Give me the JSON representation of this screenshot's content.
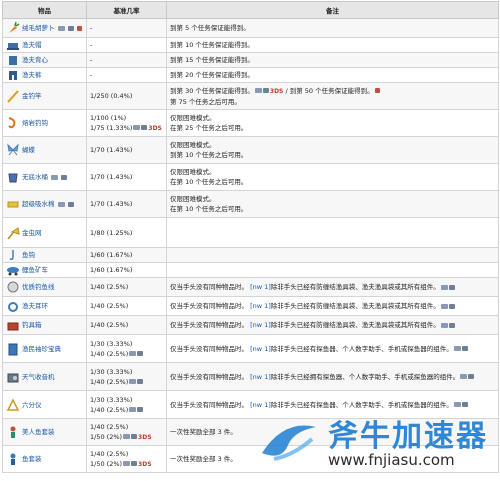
{
  "header": {
    "col_item": "物品",
    "col_rate": "基准几率",
    "col_note": "备注"
  },
  "rows": [
    {
      "name": "绒毛胡萝卜",
      "rate1": "-",
      "rate2": "",
      "note1": "到第 5 个任务保证能得到。",
      "note2": ""
    },
    {
      "name": "渔夫帽",
      "rate1": "-",
      "rate2": "",
      "note1": "到第 10 个任务保证能得到。",
      "note2": ""
    },
    {
      "name": "渔夫背心",
      "rate1": "-",
      "rate2": "",
      "note1": "到第 15 个任务保证能得到。",
      "note2": ""
    },
    {
      "name": "渔夫裤",
      "rate1": "-",
      "rate2": "",
      "note1": "到第 20 个任务保证能得到。",
      "note2": ""
    },
    {
      "name": "金钓竿",
      "rate1": "1/250 (0.4%)",
      "rate2": "",
      "note1": "到第 30 个任务保证能得到。",
      "note1b": "/ 到第 50 个任务保证能得到。",
      "note2": "第 75 个任务之后可用。"
    },
    {
      "name": "熔岩钓钩",
      "rate1": "1/100 (1%)",
      "rate2": "1/75 (1.33%)",
      "note1": "仅限困难模式。",
      "note2": "在第 25 个任务之后可用。"
    },
    {
      "name": "蝴蝶",
      "rate1": "1/70 (1.43%)",
      "rate2": "",
      "note1": "仅限困难模式。",
      "note2": "到第 10 个任务之后可用。"
    },
    {
      "name": "无底水桶",
      "rate1": "1/70 (1.43%)",
      "rate2": "",
      "note1": "仅限困难模式。",
      "note2": "在第 10 个任务之后可用。"
    },
    {
      "name": "超级吸水棉",
      "rate1": "1/70 (1.43%)",
      "rate2": "",
      "note1": "仅限困难模式。",
      "note2": "在第 10 个任务之后可用。"
    },
    {
      "name": "金虫网",
      "rate1": "1/80 (1.25%)",
      "rate2": "",
      "note1": "",
      "note2": ""
    },
    {
      "name": "鱼钩",
      "rate1": "1/60 (1.67%)",
      "rate2": "",
      "note1": "",
      "note2": ""
    },
    {
      "name": "鲤鱼矿车",
      "rate1": "1/60 (1.67%)",
      "rate2": "",
      "note1": "",
      "note2": ""
    },
    {
      "name": "优质钓鱼线",
      "rate1": "1/40 (2.5%)",
      "rate2": "",
      "note1": "仅当手头没有同种物品时。",
      "ref": "[nw 1]",
      "note_after": "除非手头已经有防缠结渔具袋、渔夫渔具袋或其所有组件。"
    },
    {
      "name": "渔夫耳环",
      "rate1": "1/40 (2.5%)",
      "rate2": "",
      "note1": "仅当手头没有同种物品时。",
      "ref": "[nw 1]",
      "note_after": "除非手头已经有防缠结渔具袋、渔夫渔具袋或其所有组件。"
    },
    {
      "name": "钓具箱",
      "rate1": "1/40 (2.5%)",
      "rate2": "",
      "note1": "仅当手头没有同种物品时。",
      "ref": "[nw 1]",
      "note_after": "除非手头已经有防缠结渔具袋、渔夫渔具袋或其所有组件。"
    },
    {
      "name": "渔民袖珍宝典",
      "rate1": "1/30 (3.33%)",
      "rate2": "1/40 (2.5%)",
      "note1": "仅当手头没有同种物品时。",
      "ref": "[nw 1]",
      "note_after": "除非手头已经有探鱼器、个人数字助手、手机或探鱼器的组件。"
    },
    {
      "name": "天气收音机",
      "rate1": "1/30 (3.33%)",
      "rate2": "1/40 (2.5%)",
      "note1": "仅当手头没有同种物品时。",
      "ref": "[nw 1]",
      "note_after": "除非手头已经拥有探鱼器、个人数字助手、手机或探鱼器的组件。"
    },
    {
      "name": "六分仪",
      "rate1": "1/30 (3.33%)",
      "rate2": "1/40 (2.5%)",
      "note1": "仅当手头没有同种物品时。",
      "ref": "[nw 1]",
      "note_after": "除非手头已经有探鱼器、个人数字助手、手机或探鱼器的组件。"
    },
    {
      "name": "美人鱼套装",
      "rate1": "1/40 (2.5%)",
      "rate2": "1/50 (2%)",
      "note1": "一次性奖励全部 3 件。",
      "note2": ""
    },
    {
      "name": "鱼套装",
      "rate1": "1/40 (2.5%)",
      "rate2": "1/50 (2%)",
      "note1": "一次性奖励全部 3 件。",
      "note2": ""
    }
  ],
  "platform_3ds": "3DS",
  "watermark": {
    "brand": "斧牛加速器",
    "url": "www.fnjiasu.com"
  },
  "colors": {
    "link": "#1a57a6",
    "header_bg": "#e6e6e6",
    "row_bg": "#f7f7f7",
    "watermark": "#1f7ed4"
  }
}
